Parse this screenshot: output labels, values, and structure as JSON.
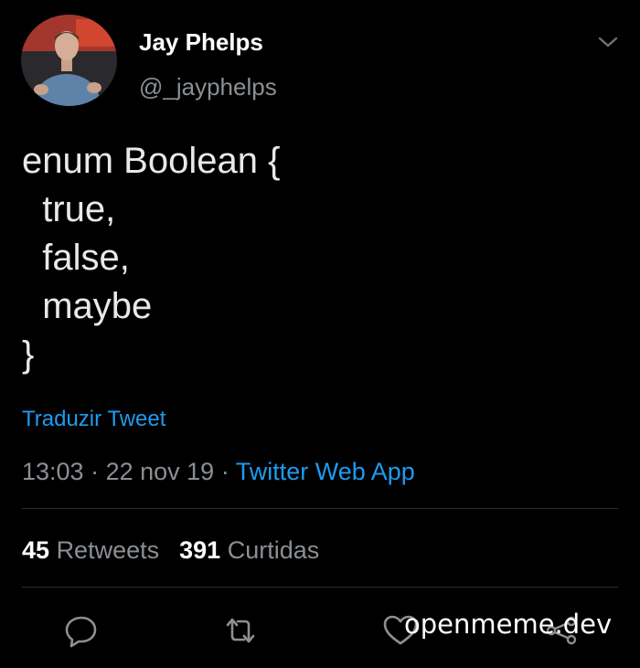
{
  "author": {
    "display_name": "Jay Phelps",
    "handle": "@_jayphelps"
  },
  "tweet": {
    "lines": [
      "enum Boolean {",
      "  true,",
      "  false,",
      "  maybe",
      "}"
    ],
    "translate_link": "Traduzir Tweet",
    "time": "13:03",
    "separator": " · ",
    "date": "22 nov 19",
    "source": "Twitter Web App"
  },
  "stats": {
    "retweets_count": "45",
    "retweets_label": "Retweets",
    "likes_count": "391",
    "likes_label": "Curtidas"
  },
  "actions": {
    "icons": [
      "reply-icon",
      "retweet-icon",
      "like-icon",
      "share-icon"
    ]
  },
  "watermark": "openmeme.dev",
  "colors": {
    "background": "#000000",
    "link": "#1d9bf0",
    "muted": "#8b8f93",
    "text": "#e7e9ea"
  }
}
